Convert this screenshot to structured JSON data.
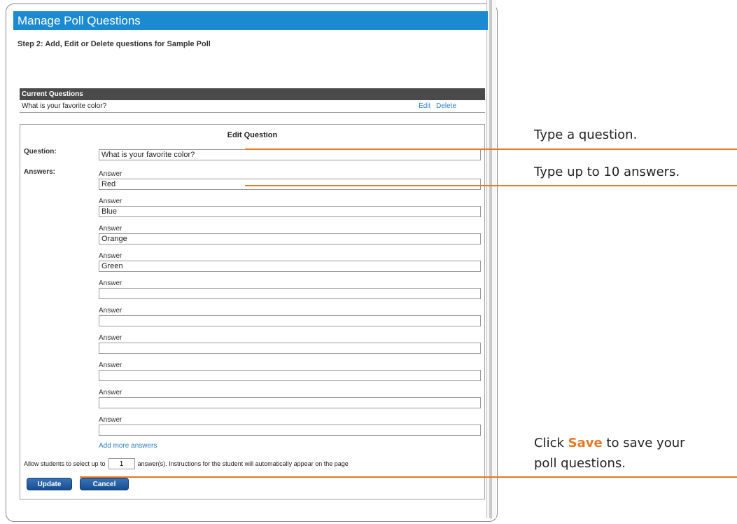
{
  "window": {
    "title": "Manage Poll Questions",
    "step_text": "Step 2: Add, Edit or Delete questions for Sample Poll"
  },
  "current_questions": {
    "header": "Current Questions",
    "items": [
      {
        "text": "What is your favorite color?",
        "edit_label": "Edit",
        "delete_label": "Delete"
      }
    ]
  },
  "edit_question": {
    "title": "Edit Question",
    "question_label": "Question:",
    "question_value": "What is your favorite color?",
    "answers_label": "Answers:",
    "answer_field_label": "Answer",
    "answers": [
      "Red",
      "Blue",
      "Orange",
      "Green",
      "",
      "",
      "",
      "",
      "",
      ""
    ],
    "add_more_label": "Add more answers",
    "allow_prefix": "Allow students to select up to",
    "allow_value": "1",
    "allow_suffix": "answer(s). Instructions for the student will automatically appear on the page",
    "update_label": "Update",
    "cancel_label": "Cancel"
  },
  "callouts": {
    "question": "Type a question.",
    "answers": "Type up to 10 answers.",
    "save_prefix": "Click ",
    "save_bold": "Save",
    "save_suffix": " to save your",
    "save_line2": "poll questions."
  },
  "colors": {
    "title_bar": "#1b8ad1",
    "header_dark": "#4a4a4a",
    "link": "#2a7fc6",
    "button": "#1c5aa3",
    "callout_accent": "#e87722"
  }
}
